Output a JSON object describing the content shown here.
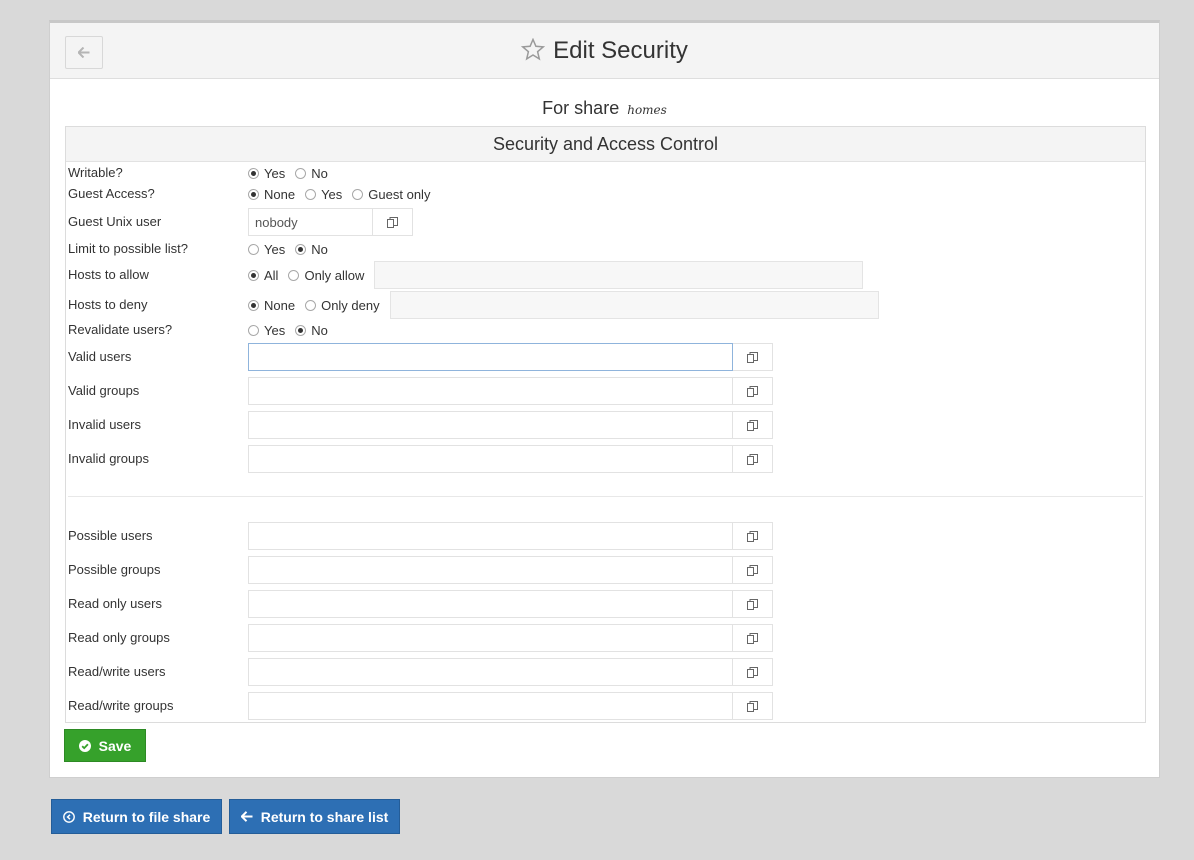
{
  "header": {
    "title": "Edit Security",
    "back_icon": "arrow-left-icon",
    "star_icon": "star-outline-icon"
  },
  "subtitle": {
    "prefix": "For share",
    "share_name": "homes"
  },
  "section": {
    "title": "Security and Access Control"
  },
  "fields": {
    "writable": {
      "label": "Writable?",
      "options": [
        "Yes",
        "No"
      ],
      "selected": "Yes"
    },
    "guest_access": {
      "label": "Guest Access?",
      "options": [
        "None",
        "Yes",
        "Guest only"
      ],
      "selected": "None"
    },
    "guest_unix_user": {
      "label": "Guest Unix user",
      "value": "nobody"
    },
    "limit_possible": {
      "label": "Limit to possible list?",
      "options": [
        "Yes",
        "No"
      ],
      "selected": "No"
    },
    "hosts_allow": {
      "label": "Hosts to allow",
      "options": [
        "All",
        "Only allow"
      ],
      "selected": "All",
      "value": ""
    },
    "hosts_deny": {
      "label": "Hosts to deny",
      "options": [
        "None",
        "Only deny"
      ],
      "selected": "None",
      "value": ""
    },
    "revalidate": {
      "label": "Revalidate users?",
      "options": [
        "Yes",
        "No"
      ],
      "selected": "No"
    },
    "valid_users": {
      "label": "Valid users",
      "value": ""
    },
    "valid_groups": {
      "label": "Valid groups",
      "value": ""
    },
    "invalid_users": {
      "label": "Invalid users",
      "value": ""
    },
    "invalid_groups": {
      "label": "Invalid groups",
      "value": ""
    },
    "possible_users": {
      "label": "Possible users",
      "value": ""
    },
    "possible_groups": {
      "label": "Possible groups",
      "value": ""
    },
    "readonly_users": {
      "label": "Read only users",
      "value": ""
    },
    "readonly_groups": {
      "label": "Read only groups",
      "value": ""
    },
    "readwrite_users": {
      "label": "Read/write users",
      "value": ""
    },
    "readwrite_groups": {
      "label": "Read/write groups",
      "value": ""
    }
  },
  "buttons": {
    "save": "Save",
    "return_file_share": "Return to file share",
    "return_share_list": "Return to share list"
  },
  "colors": {
    "save_green": "#36a12b",
    "return_blue": "#2d6fb4"
  }
}
